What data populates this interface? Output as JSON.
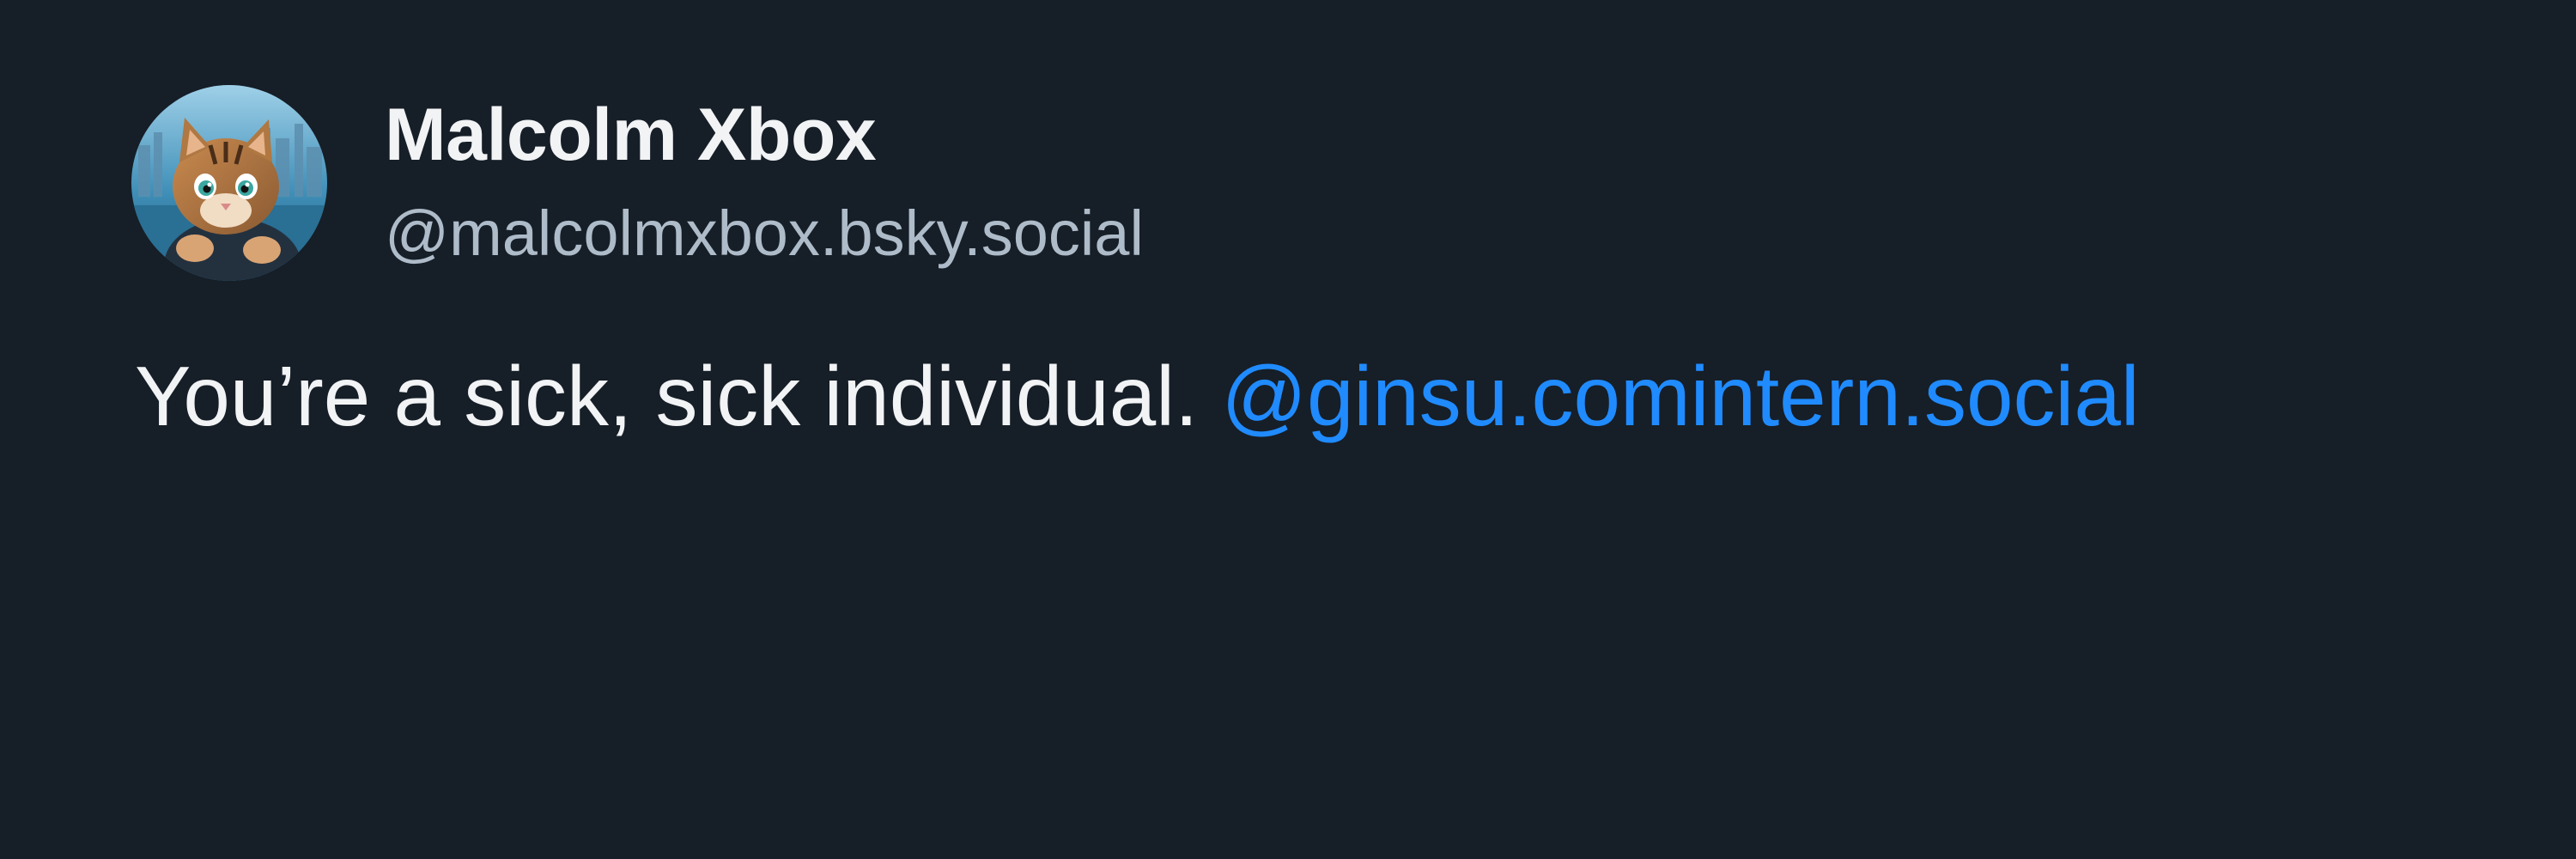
{
  "post": {
    "author": {
      "display_name": "Malcolm Xbox",
      "handle": "@malcolmxbox.bsky.social",
      "avatar_icon": "kitten-avatar"
    },
    "text": "You’re a sick, sick individual.",
    "mention": "@ginsu.comintern.social"
  },
  "colors": {
    "background": "#161e27",
    "text_primary": "#f1f3f5",
    "text_secondary": "#aebbc9",
    "link": "#208bfe"
  }
}
